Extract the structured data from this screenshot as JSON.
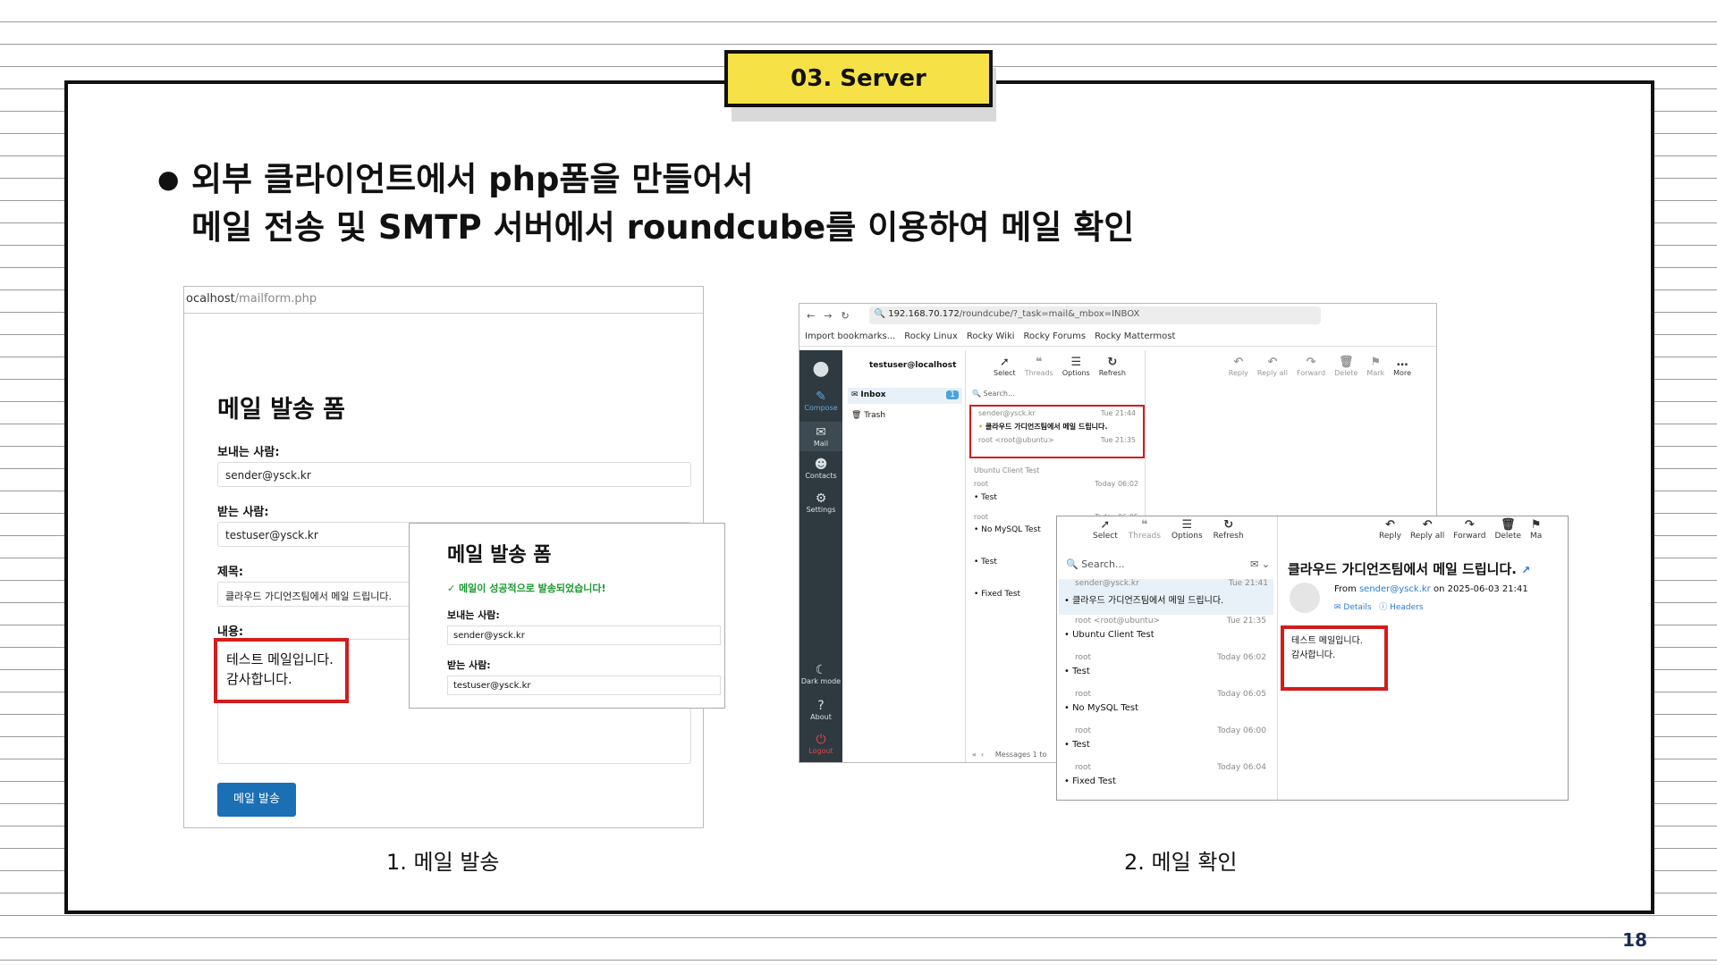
{
  "slide": {
    "section_tag": "03. Server",
    "page_number": "18",
    "heading_bullet": "●",
    "heading_line1": "외부 클라이언트에서 php폼을 만들어서",
    "heading_line2": "메일 전송 및 SMTP 서버에서 roundcube를 이용하여 메일 확인",
    "caption1": "1. 메일 발송",
    "caption2": "2. 메일 확인"
  },
  "form": {
    "url_start": "ocalhost",
    "url_rest": "/mailform.php",
    "title": "메일 발송 폼",
    "sender_label": "보내는 사람:",
    "sender_value": "sender@ysck.kr",
    "recipient_label": "받는 사람:",
    "recipient_value": "testuser@ysck.kr",
    "subject_label": "제목:",
    "subject_value": "클라우드 가디언즈팀에서 메일 드립니다.",
    "body_label": "내용:",
    "body_line1": "테스트 메일입니다.",
    "body_line2": "감사합니다.",
    "send_button": "메일 발송"
  },
  "popup": {
    "title": "메일 발송 폼",
    "success": "✓ 메일이 성공적으로 발송되었습니다!",
    "sender_label": "보내는 사람:",
    "sender_value": "sender@ysck.kr",
    "recipient_label": "받는 사람:",
    "recipient_value": "testuser@ysck.kr"
  },
  "browser": {
    "back": "←",
    "forward": "→",
    "reload": "↻",
    "address_host": "192.168.70.172",
    "address_path": "/roundcube/?_task=mail&_mbox=INBOX",
    "bookmarks": [
      "Import bookmarks...",
      "Rocky Linux",
      "Rocky Wiki",
      "Rocky Forums",
      "Rocky Mattermost"
    ]
  },
  "roundcube": {
    "sidebar": [
      "Compose",
      "Mail",
      "Contacts",
      "Settings",
      "Dark mode",
      "About",
      "Logout"
    ],
    "account": "testuser@localhost",
    "folders": [
      {
        "name": "Inbox",
        "count": "1"
      },
      {
        "name": "Trash",
        "count": ""
      }
    ],
    "toolbar_left": [
      "Select",
      "Threads",
      "Options",
      "Refresh"
    ],
    "toolbar_right": [
      "Reply",
      "Reply all",
      "Forward",
      "Delete",
      "Mark",
      "More"
    ],
    "search": "Search...",
    "messages": [
      {
        "from": "sender@ysck.kr",
        "time": "Tue 21:44",
        "subject": "클라우드 가디언즈팀에서 메일 드립니다."
      },
      {
        "from": "root <root@ubuntu>",
        "time": "Tue 21:35",
        "subject": "Ubuntu Client Test"
      },
      {
        "from": "root",
        "time": "Today 06:02",
        "subject": "Test"
      },
      {
        "from": "root",
        "time": "Today 06:05",
        "subject": "No MySQL Test"
      },
      {
        "from": "root",
        "time": "Today 06:00",
        "subject": "Test"
      },
      {
        "from": "root",
        "time": "Today 06:04",
        "subject": "Fixed Test"
      }
    ],
    "pager": "Messages 1 to"
  },
  "reader": {
    "toolbar_left": [
      "Select",
      "Threads",
      "Options",
      "Refresh"
    ],
    "toolbar_right": [
      "Reply",
      "Reply all",
      "Forward",
      "Delete",
      "Ma"
    ],
    "search": "Search...",
    "messages": [
      {
        "from": "sender@ysck.kr",
        "time": "Tue 21:41",
        "subject": "클라우드 가디언즈팀에서 메일 드립니다."
      },
      {
        "from": "root <root@ubuntu>",
        "time": "Tue 21:35",
        "subject": "Ubuntu Client Test"
      },
      {
        "from": "root",
        "time": "Today 06:02",
        "subject": "Test"
      },
      {
        "from": "root",
        "time": "Today 06:05",
        "subject": "No MySQL Test"
      },
      {
        "from": "root",
        "time": "Today 06:00",
        "subject": "Test"
      },
      {
        "from": "root",
        "time": "Today 06:04",
        "subject": "Fixed Test"
      }
    ],
    "subject": "클라우드 가디언즈팀에서 메일 드립니다.",
    "from_prefix": "From",
    "from_addr": "sender@ysck.kr",
    "from_suffix": "on 2025-06-03 21:41",
    "details": "Details",
    "headers": "Headers",
    "body_line1": "테스트 메일입니다.",
    "body_line2": "감사합니다."
  }
}
